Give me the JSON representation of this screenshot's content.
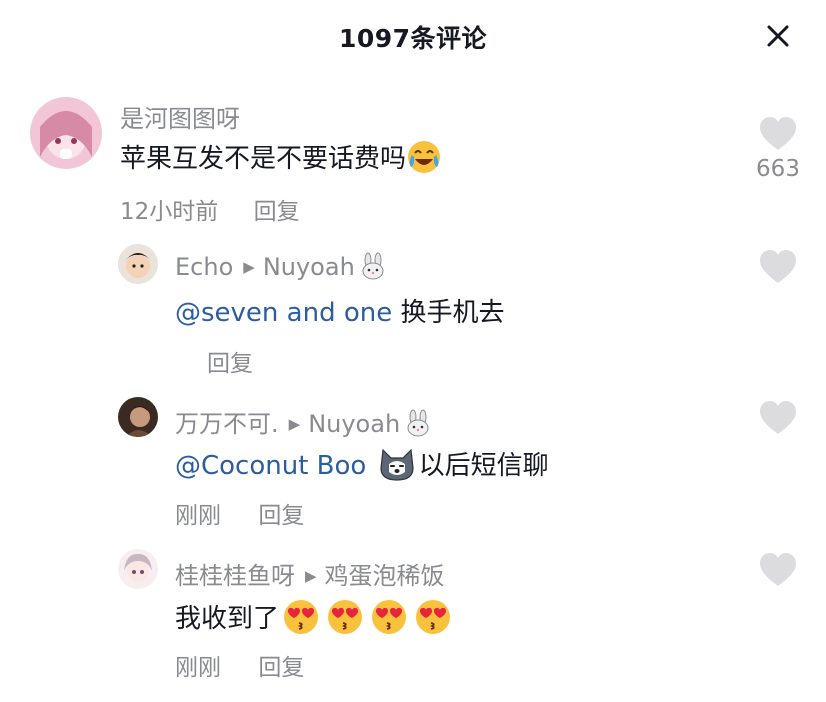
{
  "header": {
    "title": "1097条评论"
  },
  "comments": [
    {
      "username": "是河图图呀",
      "text": "苹果互发不是不要话费吗",
      "emoji": "crying-laughing-emoji",
      "time": "12小时前",
      "reply_label": "回复",
      "likes": "663",
      "replies": [
        {
          "username": "Echo",
          "reply_to": "Nuyoah",
          "reply_to_emoji": "rabbit-emoji",
          "mention": "@seven and one",
          "text": " 换手机去",
          "time": "",
          "reply_label": "回复"
        },
        {
          "username": "万万不可.",
          "reply_to": "Nuyoah",
          "reply_to_emoji": "rabbit-emoji",
          "mention": "@Coconut Boo",
          "emoji": "husky-dog-emoji",
          "text": "以后短信聊",
          "time": "刚刚",
          "reply_label": "回复"
        },
        {
          "username": "桂桂桂鱼呀",
          "reply_to": "鸡蛋泡稀饭",
          "text": "我收到了",
          "emojis": [
            "heart-eyes-kiss-emoji",
            "heart-eyes-kiss-emoji",
            "heart-eyes-kiss-emoji",
            "heart-eyes-kiss-emoji"
          ],
          "time": "刚刚",
          "reply_label": "回复"
        }
      ]
    }
  ],
  "colors": {
    "text_primary": "#161823",
    "text_secondary": "#8a8b91",
    "mention": "#2b5da0",
    "like_icon": "#dcdcde"
  }
}
